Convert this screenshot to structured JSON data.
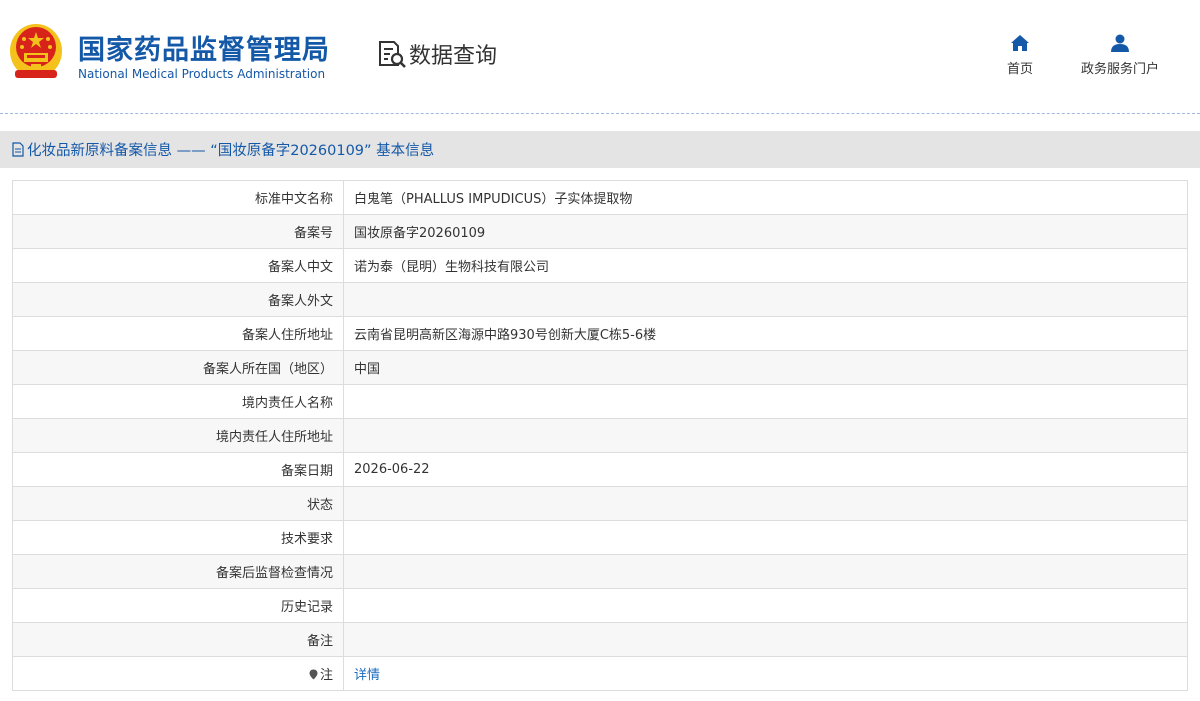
{
  "header": {
    "org_name_cn": "国家药品监督管理局",
    "org_name_en": "National Medical Products Administration",
    "section_label": "数据查询",
    "nav": {
      "home_label": "首页",
      "portal_label": "政务服务门户"
    }
  },
  "page_title": "化妆品新原料备案信息 —— “国妆原备字20260109” 基本信息",
  "rows": {
    "r1": {
      "label": "标准中文名称",
      "value": "白鬼笔（PHALLUS IMPUDICUS）子实体提取物"
    },
    "r2": {
      "label": "备案号",
      "value": "国妆原备字20260109"
    },
    "r3": {
      "label": "备案人中文",
      "value": "诺为泰（昆明）生物科技有限公司"
    },
    "r4": {
      "label": "备案人外文",
      "value": ""
    },
    "r5": {
      "label": "备案人住所地址",
      "value": "云南省昆明高新区海源中路930号创新大厦C栋5-6楼"
    },
    "r6": {
      "label": "备案人所在国（地区）",
      "value": "中国"
    },
    "r7": {
      "label": "境内责任人名称",
      "value": ""
    },
    "r8": {
      "label": "境内责任人住所地址",
      "value": ""
    },
    "r9": {
      "label": "备案日期",
      "value": "2026-06-22"
    },
    "r10": {
      "label": "状态",
      "value": ""
    },
    "r11": {
      "label": "技术要求",
      "value": ""
    },
    "r12": {
      "label": "备案后监督检查情况",
      "value": ""
    },
    "r13": {
      "label": "历史记录",
      "value": ""
    },
    "r14": {
      "label": "备注",
      "value": ""
    },
    "r15": {
      "label": "注",
      "value": "详情"
    }
  },
  "colors": {
    "brand_blue": "#1458a8",
    "emblem_red": "#d8231b",
    "emblem_gold": "#f4c21b",
    "link": "#1a6bbf"
  },
  "icons": {
    "emblem": "national-emblem-icon",
    "data_query": "data-query-icon",
    "home": "home-icon",
    "portal": "user-icon",
    "title": "document-icon",
    "note": "location-pin-icon"
  }
}
